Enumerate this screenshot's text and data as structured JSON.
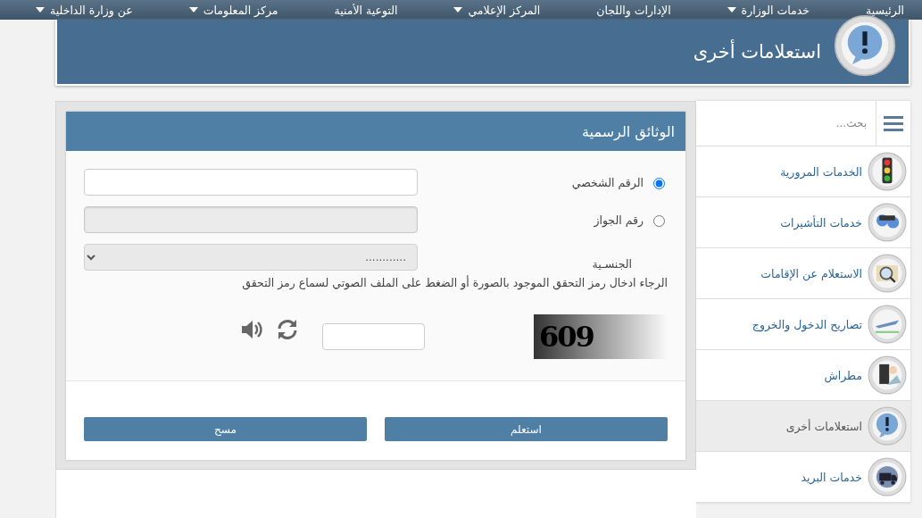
{
  "nav": {
    "items": [
      {
        "label": "الرئيسية",
        "has_menu": false
      },
      {
        "label": "خدمات الوزارة",
        "has_menu": true
      },
      {
        "label": "الإدارات واللجان",
        "has_menu": false
      },
      {
        "label": "المركز الإعلامي",
        "has_menu": true
      },
      {
        "label": "التوعية الأمنية",
        "has_menu": false
      },
      {
        "label": "مركز المعلومات",
        "has_menu": true
      },
      {
        "label": "عن وزارة الداخلية",
        "has_menu": true
      }
    ]
  },
  "header": {
    "title": "استعلامات أخرى"
  },
  "sidebar": {
    "search": {
      "placeholder": "بحث..."
    },
    "items": [
      {
        "label": "الخدمات المرورية",
        "kind": "traffic",
        "selected": false
      },
      {
        "label": "خدمات التأشيرات",
        "kind": "visa",
        "selected": false
      },
      {
        "label": "الاستعلام عن الإقامات",
        "kind": "residence",
        "selected": false
      },
      {
        "label": "تصاريح الدخول والخروج",
        "kind": "plane",
        "selected": false
      },
      {
        "label": "مطراش",
        "kind": "mail",
        "selected": false
      },
      {
        "label": "استعلامات أخرى",
        "kind": "info",
        "selected": true
      },
      {
        "label": "خدمات البريد",
        "kind": "truck",
        "selected": false
      }
    ]
  },
  "form": {
    "title": "الوثائق الرسمية",
    "options": [
      {
        "label": "الرقم الشخصي",
        "selected": true,
        "disabled": false
      },
      {
        "label": "رقم الجواز",
        "selected": false,
        "disabled": true
      }
    ],
    "nationality": {
      "label": "الجنسـية",
      "value": "............",
      "disabled": true
    },
    "instruction": "الرجاء ادخال رمز التحقق الموجود بالصورة أو الضغط على الملف الصوتي لسماع رمز التحقق",
    "captcha": {
      "code": "609"
    },
    "buttons": [
      {
        "label": "استعلم"
      },
      {
        "label": "مسح"
      }
    ]
  }
}
